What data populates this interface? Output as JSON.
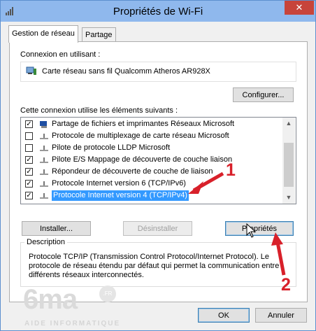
{
  "window": {
    "title": "Propriétés de Wi-Fi",
    "close_glyph": "✕"
  },
  "tabs": [
    {
      "label": "Gestion de réseau",
      "active": true
    },
    {
      "label": "Partage",
      "active": false
    }
  ],
  "connection": {
    "label": "Connexion en utilisant :",
    "adapter": "Carte réseau sans fil Qualcomm Atheros AR928X",
    "configure_button": "Configurer..."
  },
  "components": {
    "label": "Cette connexion utilise les éléments suivants :",
    "items": [
      {
        "text": "Partage de fichiers et imprimantes Réseaux Microsoft",
        "checked": true,
        "icon": "network-client-icon",
        "selected": false
      },
      {
        "text": "Protocole de multiplexage de carte réseau Microsoft",
        "checked": false,
        "icon": "protocol-icon",
        "selected": false
      },
      {
        "text": "Pilote de protocole LLDP Microsoft",
        "checked": false,
        "icon": "protocol-icon",
        "selected": false
      },
      {
        "text": "Pilote E/S Mappage de découverte de couche liaison",
        "checked": true,
        "icon": "protocol-icon",
        "selected": false
      },
      {
        "text": "Répondeur de découverte de couche de liaison",
        "checked": true,
        "icon": "protocol-icon",
        "selected": false
      },
      {
        "text": "Protocole Internet version 6 (TCP/IPv6)",
        "checked": true,
        "icon": "protocol-icon",
        "selected": false
      },
      {
        "text": "Protocole Internet version 4 (TCP/IPv4)",
        "checked": true,
        "icon": "protocol-icon",
        "selected": true
      }
    ],
    "install_button": "Installer...",
    "uninstall_button": "Désinstaller",
    "properties_button": "Propriétés"
  },
  "description": {
    "title": "Description",
    "lines": [
      "Protocole TCP/IP (Transmission Control Protocol/Internet Protocol). Le",
      "protocole de réseau étendu par défaut qui permet la communication entre",
      "différents réseaux interconnectés."
    ]
  },
  "footer": {
    "ok_button": "OK",
    "cancel_button": "Annuler"
  },
  "watermark": {
    "brand": "6ma",
    "badge": ".FR",
    "tagline": "AIDE INFORMATIQUE"
  },
  "annotations": {
    "step1": "1",
    "step2": "2"
  },
  "colors": {
    "selection": "#3399ff",
    "titlebar": "#8fb8ed",
    "close": "#c7443b",
    "annotation": "#d8202a"
  }
}
